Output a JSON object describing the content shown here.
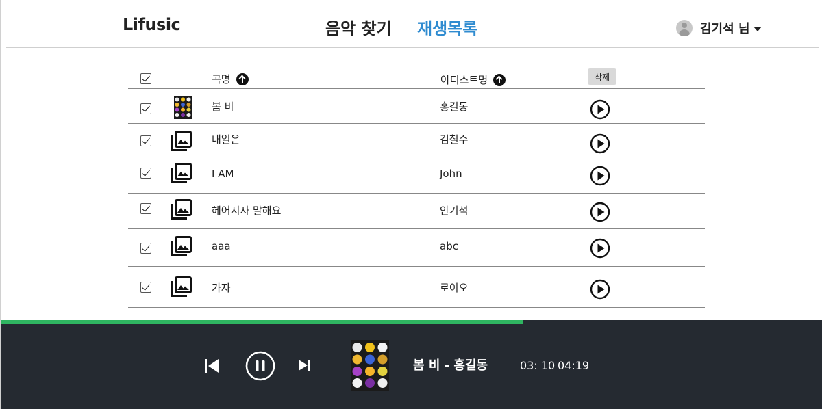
{
  "header": {
    "logo": "Lifusic",
    "nav": {
      "find": "음악 찾기",
      "playlist": "재생목록"
    },
    "user_name": "김기석 님"
  },
  "table": {
    "col_title": "곡명",
    "col_artist": "아티스트명",
    "delete_label": "삭제",
    "rows": [
      {
        "title": "봄 비",
        "artist": "홍길동",
        "checked": true,
        "has_cover": true
      },
      {
        "title": "내일은",
        "artist": "김철수",
        "checked": true,
        "has_cover": false
      },
      {
        "title": "I AM",
        "artist": "John",
        "checked": true,
        "has_cover": false
      },
      {
        "title": "헤어지자 말해요",
        "artist": "안기석",
        "checked": true,
        "has_cover": false
      },
      {
        "title": "aaa",
        "artist": "abc",
        "checked": true,
        "has_cover": false
      },
      {
        "title": "가자",
        "artist": "로이오",
        "checked": true,
        "has_cover": false
      }
    ]
  },
  "player": {
    "now_playing": "봄 비 - 홍길동",
    "current_time": "03: 10",
    "total_time": "04:19",
    "progress": 0.635,
    "accent_color": "#2fb561",
    "bg_color": "#252a31"
  }
}
